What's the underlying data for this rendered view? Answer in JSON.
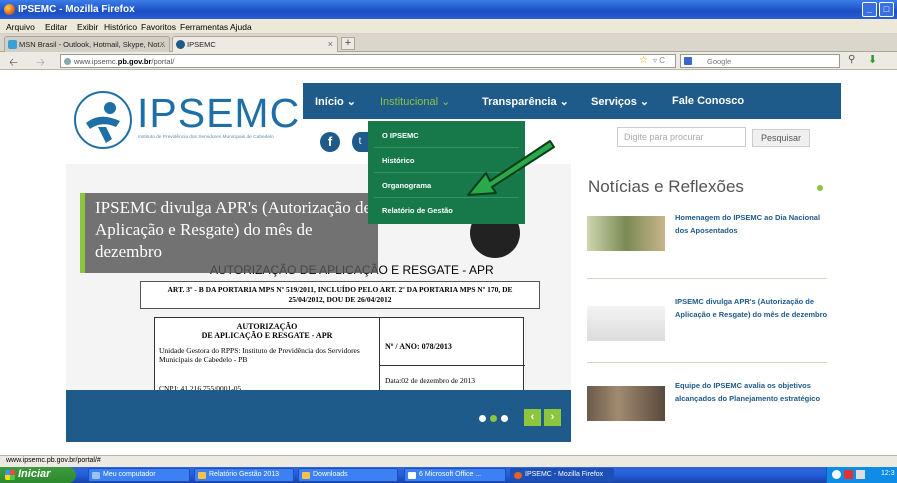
{
  "window": {
    "title": "IPSEMC - Mozilla Firefox",
    "buttons": {
      "minimize": "_",
      "maximize": "□"
    }
  },
  "menu": [
    "Arquivo",
    "Editar",
    "Exibir",
    "Histórico",
    "Favoritos",
    "Ferramentas",
    "Ajuda"
  ],
  "tabs": [
    {
      "label": "MSN Brasil - Outlook, Hotmail, Skype, Not...",
      "close": "×"
    },
    {
      "label": "IPSEMC",
      "close": "×"
    }
  ],
  "new_tab": "+",
  "address": {
    "prefix": "www.ipsemc.",
    "domain": "pb.gov.br",
    "path": "/portal/"
  },
  "browser_search": {
    "placeholder": "Google"
  },
  "site": {
    "logo_text": "IPSEMC",
    "logo_subtitle": "Instituto de Previdência dos Servidores Municipais de Cabedelo",
    "nav": [
      {
        "label": "Início ⌄"
      },
      {
        "label": "Institucional ⌄"
      },
      {
        "label": "Transparência ⌄"
      },
      {
        "label": "Serviços ⌄"
      },
      {
        "label": "Fale Conosco"
      }
    ],
    "dropdown": [
      "O IPSEMC",
      "Histórico",
      "Organograma",
      "Relatório de Gestão"
    ],
    "social": {
      "facebook": "f",
      "twitter": "t"
    },
    "search_placeholder": "Digite para procurar",
    "search_button": "Pesquisar",
    "slide": {
      "caption": "IPSEMC divulga APR's (Autorização de Aplicação e Resgate) do mês de dezembro",
      "doc_heading": "AUTORIZAÇÃO DE APLICAÇÃO E RESGATE - APR",
      "doc_art": "ART. 3º - B DA PORTARIA MPS Nº 519/2011, INCLUÍDO PELO ART. 2º DA PORTARIA MPS Nº 170, DE 25/04/2012, DOU DE 26/04/2012",
      "doc_table_title_1": "AUTORIZAÇÃO",
      "doc_table_title_2": "DE APLICAÇÃO E RESGATE - APR",
      "doc_unit": "Unidade Gestora do RPPS: Instituto de Previdência dos Servidores Municipais de Cabedelo - PB",
      "doc_cnpj": "CNPJ: 41.216.755/0001-05",
      "doc_number": "Nº / ANO: 078/2013",
      "doc_date": "Data:02 de dezembro de 2013",
      "prev": "‹",
      "next": "›"
    },
    "news_title": "Notícias e Reflexões",
    "news": [
      {
        "title": "Homenagem do IPSEMC ao Dia Nacional dos Aposentados"
      },
      {
        "title": "IPSEMC divulga APR's (Autorização de Aplicação e Resgate) do mês de dezembro"
      },
      {
        "title": "Equipe do IPSEMC avalia os objetivos alcançados do Planejamento estratégico"
      }
    ]
  },
  "status_url": "www.ipsemc.pb.gov.br/portal/#",
  "taskbar": {
    "start": "Iniciar",
    "items": [
      "Meu computador",
      "Relatório Gestão 2013",
      "Downloads",
      "6 Microsoft Office ...",
      "IPSEMC - Mozilla Firefox"
    ],
    "clock": "12:3"
  },
  "colors": {
    "nav_bg": "#1e5a8a",
    "accent_green": "#8cc63f",
    "dropdown_bg": "#17794a"
  }
}
